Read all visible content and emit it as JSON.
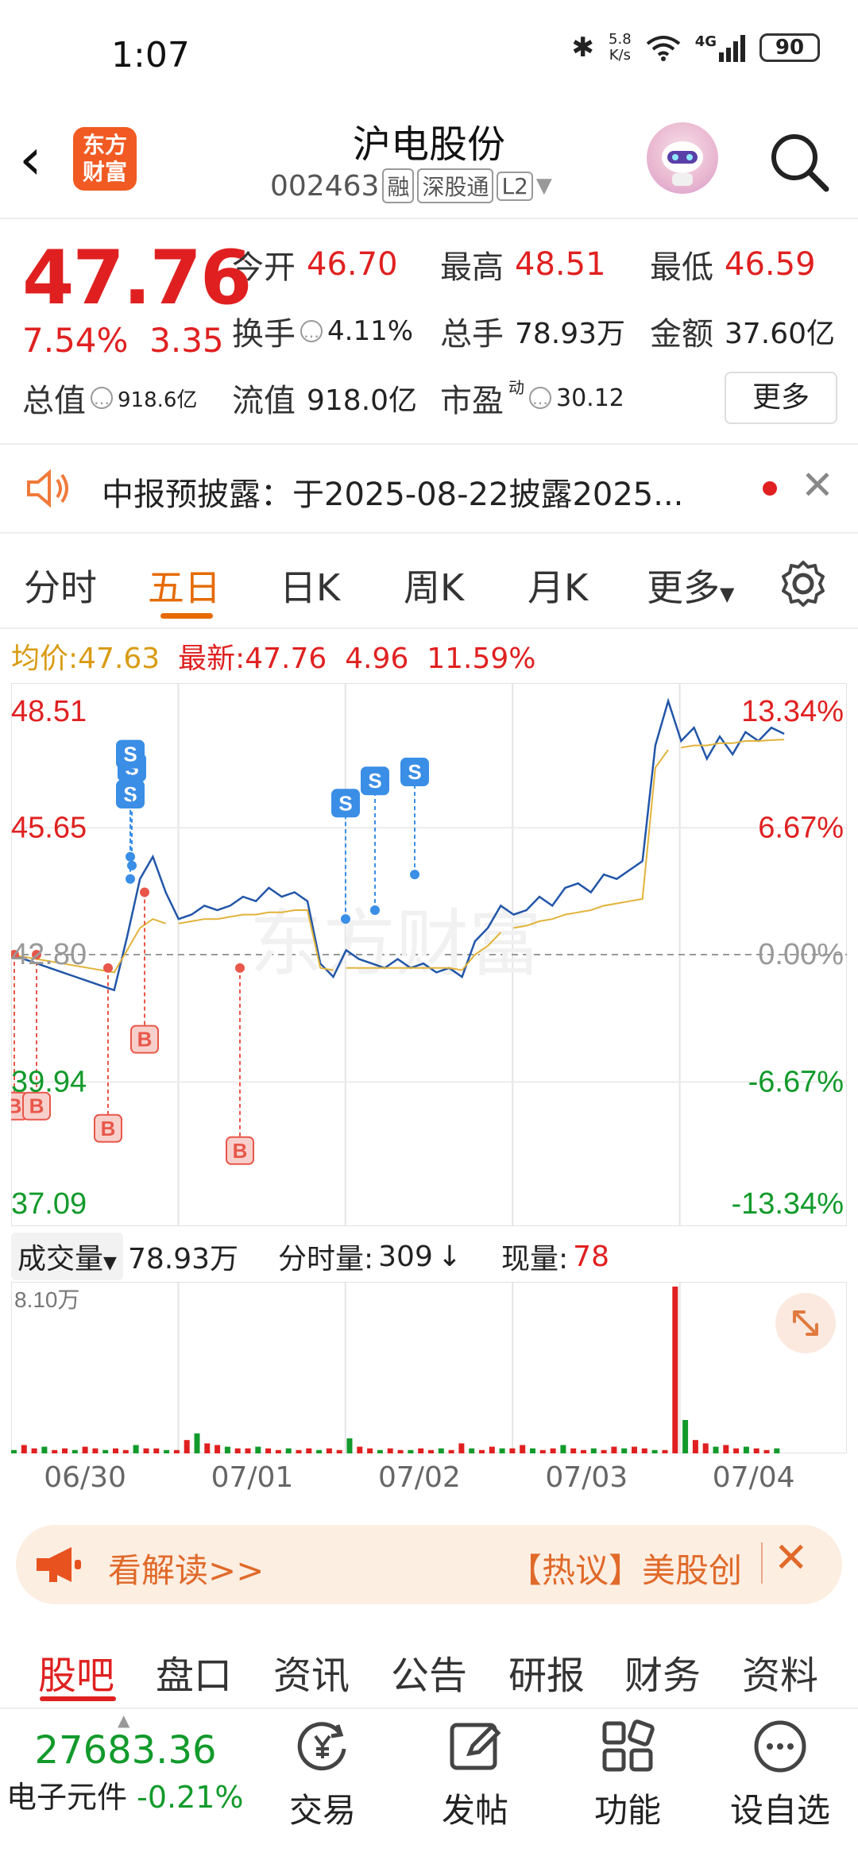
{
  "status_bar": {
    "time": "1:07",
    "net_speed_top": "5.8",
    "net_speed_bottom": "K/s",
    "network": "4G",
    "battery": "90"
  },
  "header": {
    "logo_line1": "东方",
    "logo_line2": "财富",
    "title": "沪电股份",
    "code": "002463",
    "tag1": "融",
    "tag2": "深股通",
    "tag3": "L2"
  },
  "quote": {
    "price": "47.76",
    "change_pct": "7.54%",
    "change_abs": "3.35",
    "open_label": "今开",
    "open": "46.70",
    "high_label": "最高",
    "high": "48.51",
    "low_label": "最低",
    "low": "46.59",
    "turnover_label": "换手",
    "turnover": "4.11%",
    "volume_label": "总手",
    "volume": "78.93万",
    "amount_label": "金额",
    "amount": "37.60亿",
    "mktcap_label": "总值",
    "mktcap": "918.6亿",
    "float_label": "流值",
    "float_cap": "918.0亿",
    "pe_label": "市盈",
    "pe_sup": "动",
    "pe": "30.12",
    "more_label": "更多"
  },
  "notice": {
    "text": "中报预披露：于2025-08-22披露2025..."
  },
  "tabs": [
    "分时",
    "五日",
    "日K",
    "周K",
    "月K",
    "更多"
  ],
  "legend": {
    "avg_label": "均价:",
    "avg": "47.63",
    "latest_label": "最新:",
    "latest": "47.76",
    "chg": "4.96",
    "pct": "11.59%"
  },
  "chart_data": {
    "type": "line",
    "title": "",
    "y_left_ticks": [
      "48.51",
      "45.65",
      "42.80",
      "39.94",
      "37.09"
    ],
    "y_right_ticks": [
      "13.34%",
      "6.67%",
      "0.00%",
      "-6.67%",
      "-13.34%"
    ],
    "ylim": [
      37.09,
      48.51
    ],
    "baseline": 42.8,
    "x_days": [
      "06/30",
      "07/01",
      "07/02",
      "07/03",
      "07/04"
    ],
    "series": [
      {
        "values": [
          42.8,
          42.7,
          42.6,
          42.5,
          42.4,
          42.3,
          42.2,
          42.1,
          42.0,
          43.2,
          44.5,
          45.0,
          44.2,
          43.6,
          43.7,
          43.9,
          43.8,
          43.9,
          44.1,
          44.0,
          44.3,
          44.1,
          44.2,
          44.0,
          42.6,
          42.3,
          42.9,
          42.7,
          42.6,
          42.5,
          42.7,
          42.5,
          42.6,
          42.4,
          42.5,
          42.3,
          43.1,
          43.4,
          43.9,
          43.7,
          43.8,
          44.1,
          43.9,
          44.3,
          44.4,
          44.2,
          44.6,
          44.5,
          44.7,
          44.9,
          47.5,
          48.5,
          47.6,
          47.9,
          47.2,
          47.7,
          47.3,
          47.8,
          47.6,
          47.9,
          47.76
        ]
      },
      {
        "values": [
          42.8,
          42.75,
          42.7,
          42.65,
          42.6,
          42.55,
          42.5,
          42.45,
          42.4,
          42.9,
          43.4,
          43.6,
          43.5,
          43.5,
          43.55,
          43.6,
          43.6,
          43.65,
          43.7,
          43.7,
          43.75,
          43.75,
          43.8,
          43.8,
          42.5,
          42.45,
          42.5,
          42.5,
          42.5,
          42.5,
          42.5,
          42.5,
          42.5,
          42.5,
          42.5,
          42.45,
          42.8,
          43.0,
          43.3,
          43.4,
          43.45,
          43.55,
          43.6,
          43.7,
          43.75,
          43.8,
          43.9,
          43.95,
          44.0,
          44.05,
          47.0,
          47.4,
          47.45,
          47.5,
          47.5,
          47.55,
          47.55,
          47.6,
          47.6,
          47.62,
          47.63
        ]
      }
    ],
    "grid": true
  },
  "signals": [
    {
      "label": "B",
      "type": "buy"
    },
    {
      "label": "B",
      "type": "buy"
    },
    {
      "label": "B",
      "type": "buy"
    },
    {
      "label": "S",
      "type": "sell"
    },
    {
      "label": "S",
      "type": "sell"
    },
    {
      "label": "S",
      "type": "sell"
    },
    {
      "label": "B",
      "type": "buy"
    },
    {
      "label": "B",
      "type": "buy"
    },
    {
      "label": "S",
      "type": "sell"
    },
    {
      "label": "S",
      "type": "sell"
    },
    {
      "label": "S",
      "type": "sell"
    }
  ],
  "watermark": "东方财富",
  "volume_bar": {
    "label": "成交量",
    "total": "78.93万",
    "minute_label": "分时量:",
    "minute": "309",
    "current_label": "现量:",
    "current": "78",
    "max": "8.10万"
  },
  "volume_chart": {
    "values": [
      2,
      5,
      3,
      4,
      2,
      3,
      2,
      4,
      3,
      2,
      3,
      2,
      5,
      3,
      3,
      2,
      2,
      8,
      12,
      6,
      5,
      4,
      3,
      3,
      4,
      3,
      2,
      3,
      2,
      3,
      2,
      3,
      2,
      9,
      4,
      3,
      2,
      3,
      2,
      2,
      3,
      2,
      3,
      2,
      6,
      3,
      2,
      4,
      3,
      3,
      5,
      3,
      2,
      3,
      5,
      3,
      2,
      3,
      2,
      4,
      3,
      4,
      3,
      2,
      2,
      100,
      20,
      8,
      6,
      4,
      5,
      3,
      4,
      3,
      2,
      3
    ]
  },
  "banner": {
    "text": "看解读>>",
    "hot_label": "【热议】",
    "hot_text": "美股创"
  },
  "bottom_tabs": [
    "股吧",
    "盘口",
    "资讯",
    "公告",
    "研报",
    "财务",
    "资料"
  ],
  "index": {
    "value": "27683.36",
    "name": "电子元件",
    "chg": "-0.21%"
  },
  "nav": [
    "交易",
    "发帖",
    "功能",
    "设自选"
  ],
  "colors": {
    "up": "#e02020",
    "down": "#129a2b",
    "accent": "#e66a00",
    "avg_line": "#e2b33a",
    "price_line": "#2256a8"
  }
}
